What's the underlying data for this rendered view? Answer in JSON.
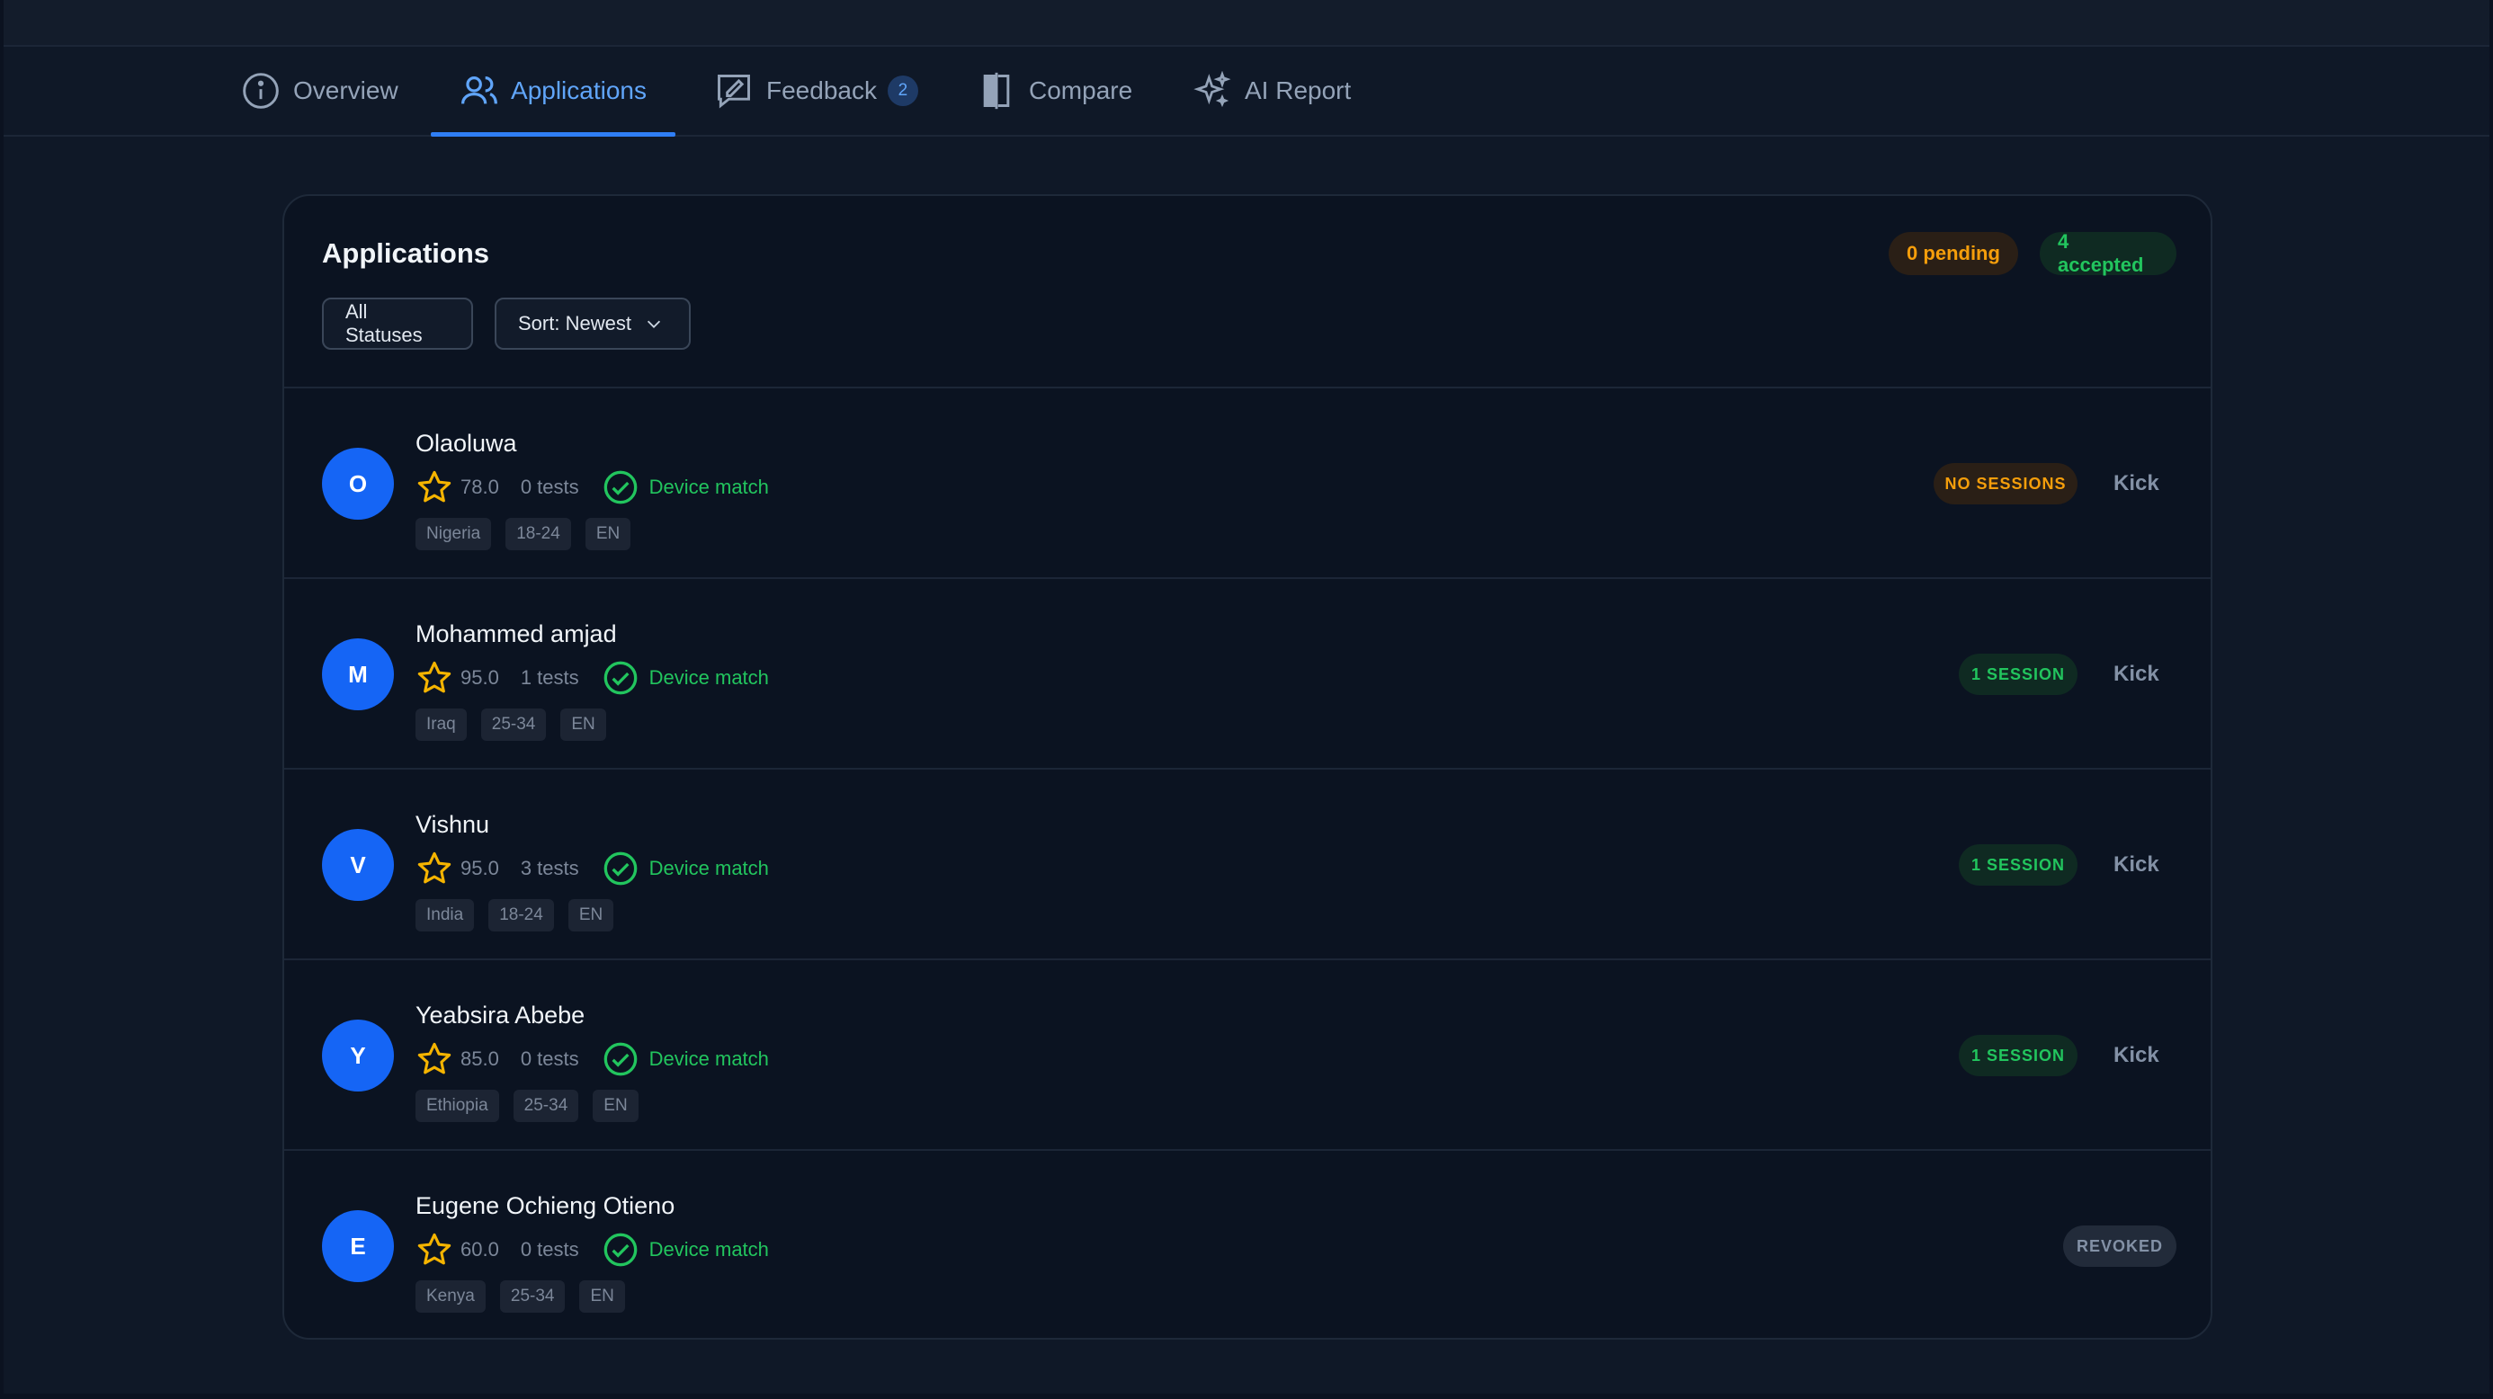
{
  "tabs": [
    {
      "label": "Overview",
      "icon": "info-icon"
    },
    {
      "label": "Applications",
      "icon": "users-icon",
      "active": true
    },
    {
      "label": "Feedback",
      "icon": "feedback-icon",
      "badge": "2"
    },
    {
      "label": "Compare",
      "icon": "compare-icon"
    },
    {
      "label": "AI Report",
      "icon": "sparkles-icon"
    }
  ],
  "applications": {
    "title": "Applications",
    "pending_label": "0 pending",
    "accepted_label": "4 accepted",
    "filter_label": "All Statuses",
    "sort_label": "Sort: Newest",
    "colors": {
      "accent": "#1565f5",
      "success": "#22c55e",
      "warning": "#f59e0b",
      "star": "#f5b400"
    },
    "rows": [
      {
        "initial": "O",
        "name": "Olaoluwa",
        "rating": "78.0",
        "tests": "0 tests",
        "device": "Device match",
        "tags": [
          "Nigeria",
          "18-24",
          "EN"
        ],
        "status": "NO SESSIONS",
        "action": "Kick"
      },
      {
        "initial": "M",
        "name": "Mohammed amjad",
        "rating": "95.0",
        "tests": "1 tests",
        "device": "Device match",
        "tags": [
          "Iraq",
          "25-34",
          "EN"
        ],
        "status": "1 SESSION",
        "action": "Kick"
      },
      {
        "initial": "V",
        "name": "Vishnu",
        "rating": "95.0",
        "tests": "3 tests",
        "device": "Device match",
        "tags": [
          "India",
          "18-24",
          "EN"
        ],
        "status": "1 SESSION",
        "action": "Kick"
      },
      {
        "initial": "Y",
        "name": "Yeabsira Abebe",
        "rating": "85.0",
        "tests": "0 tests",
        "device": "Device match",
        "tags": [
          "Ethiopia",
          "25-34",
          "EN"
        ],
        "status": "1 SESSION",
        "action": "Kick"
      },
      {
        "initial": "E",
        "name": "Eugene Ochieng Otieno",
        "rating": "60.0",
        "tests": "0 tests",
        "device": "Device match",
        "tags": [
          "Kenya",
          "25-34",
          "EN"
        ],
        "status": "REVOKED",
        "action": ""
      }
    ]
  }
}
